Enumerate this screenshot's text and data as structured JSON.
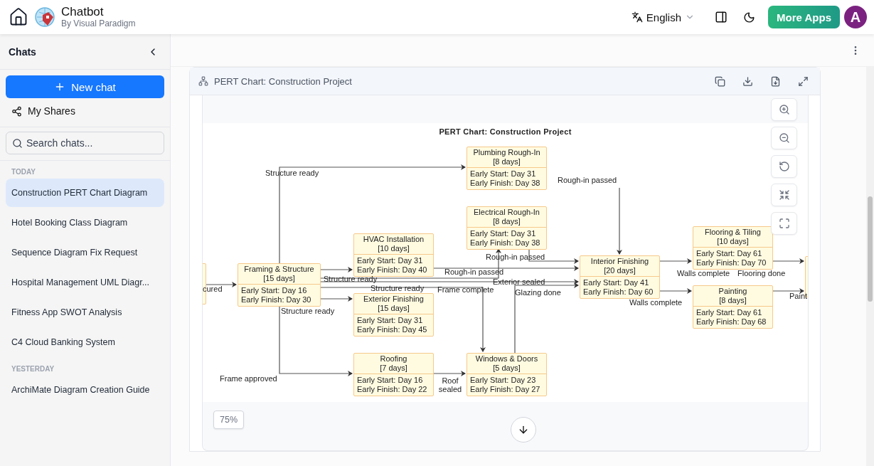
{
  "header": {
    "title": "Chatbot",
    "subtitle": "By Visual Paradigm",
    "language": "English",
    "more_apps": "More Apps",
    "avatar": "A"
  },
  "sidebar": {
    "title": "Chats",
    "new_chat": "New chat",
    "my_shares": "My Shares",
    "search_placeholder": "Search chats...",
    "groups": [
      {
        "label": "TODAY",
        "items": [
          {
            "title": "Construction PERT Chart Diagram",
            "selected": true
          },
          {
            "title": "Hotel Booking Class Diagram",
            "selected": false
          },
          {
            "title": "Sequence Diagram Fix Request",
            "selected": false
          },
          {
            "title": "Hospital Management UML Diagr...",
            "selected": false
          },
          {
            "title": "Fitness App SWOT Analysis",
            "selected": false
          },
          {
            "title": "C4 Cloud Banking System",
            "selected": false
          }
        ]
      },
      {
        "label": "YESTERDAY",
        "items": [
          {
            "title": "ArchiMate Diagram Creation Guide",
            "selected": false
          }
        ]
      }
    ]
  },
  "artifact": {
    "title": "PERT Chart: Construction Project",
    "zoom_level": "75%",
    "diagram": {
      "title": "PERT Chart: Construction Project",
      "nodes": [
        {
          "kind": "task",
          "name": "Plumbing Rough-In",
          "duration": "[8 days]",
          "early_start": "Early Start: Day 31",
          "early_finish": "Early Finish: Day 38"
        },
        {
          "kind": "task",
          "name": "Electrical Rough-In",
          "duration": "[8 days]",
          "early_start": "Early Start: Day 31",
          "early_finish": "Early Finish: Day 38"
        },
        {
          "kind": "task",
          "name": "HVAC Installation",
          "duration": "[10 days]",
          "early_start": "Early Start: Day 31",
          "early_finish": "Early Finish: Day 40"
        },
        {
          "kind": "task",
          "name": "Framing & Structure",
          "duration": "[15 days]",
          "early_start": "Early Start: Day 16",
          "early_finish": "Early Finish: Day 30"
        },
        {
          "kind": "task",
          "name": "Exterior Finishing",
          "duration": "[15 days]",
          "early_start": "Early Start: Day 31",
          "early_finish": "Early Finish: Day 45"
        },
        {
          "kind": "task",
          "name": "Roofing",
          "duration": "[7 days]",
          "early_start": "Early Start: Day 16",
          "early_finish": "Early Finish: Day 22"
        },
        {
          "kind": "task",
          "name": "Windows & Doors",
          "duration": "[5 days]",
          "early_start": "Early Start: Day 23",
          "early_finish": "Early Finish: Day 27"
        },
        {
          "kind": "task",
          "name": "Interior Finishing",
          "duration": "[20 days]",
          "early_start": "Early Start: Day 41",
          "early_finish": "Early Finish: Day 60"
        },
        {
          "kind": "task",
          "name": "Flooring & Tiling",
          "duration": "[10 days]",
          "early_start": "Early Start: Day 61",
          "early_finish": "Early Finish: Day 70"
        },
        {
          "kind": "task",
          "name": "Painting",
          "duration": "[8 days]",
          "early_start": "Early Start: Day 61",
          "early_finish": "Early Finish: Day 68"
        },
        {
          "kind": "cut"
        },
        {
          "kind": "cut"
        }
      ],
      "edge_labels": [
        "Structure ready",
        "Rough-in passed",
        "Rough-in passed",
        "Structure ready",
        "Rough-in passed",
        "Structure ready",
        "Frame complete",
        "Exterior sealed",
        "Glazing done",
        "Structure ready",
        "Walls complete",
        "Flooring done",
        "Walls complete",
        "Paint",
        "cured",
        "Frame approved",
        "Roof sealed"
      ]
    }
  }
}
